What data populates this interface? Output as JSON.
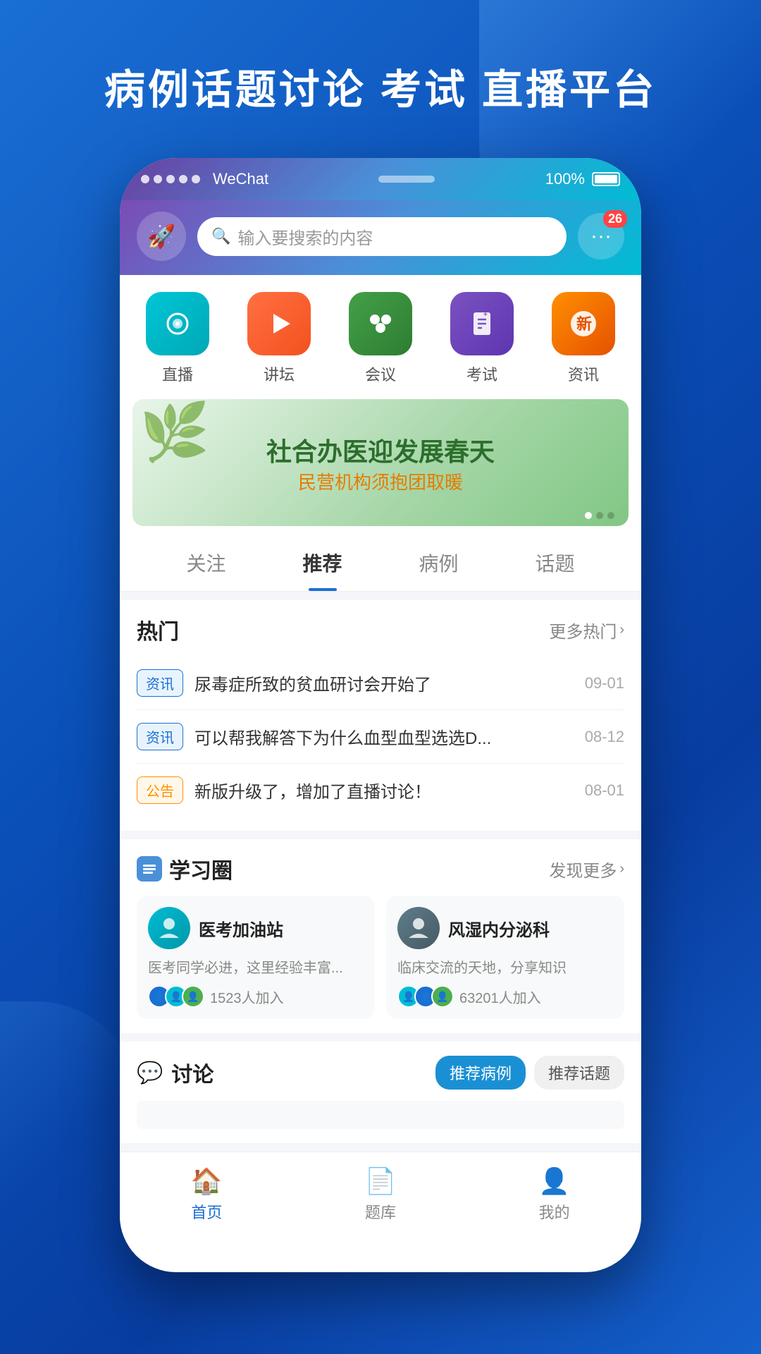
{
  "background": {
    "gradient_start": "#1a6fd4",
    "gradient_end": "#083da0"
  },
  "page_title": "病例话题讨论 考试 直播平台",
  "status_bar": {
    "app_name": "WeChat",
    "battery": "100%",
    "notification_count": "26"
  },
  "header": {
    "logo_icon": "🚀",
    "search_placeholder": "输入要搜索的内容",
    "notification_badge": "26"
  },
  "nav_icons": [
    {
      "label": "直播",
      "icon": "📡",
      "class": "icon-zibo"
    },
    {
      "label": "讲坛",
      "icon": "▶",
      "class": "icon-luntan"
    },
    {
      "label": "会议",
      "icon": "👥",
      "class": "icon-huiyi"
    },
    {
      "label": "考试",
      "icon": "📋",
      "class": "icon-kaoshi"
    },
    {
      "label": "资讯",
      "icon": "🎫",
      "class": "icon-zixun"
    }
  ],
  "banner": {
    "main_text": "社合办医迎发展春天",
    "sub_text": "民营机构须抱团取暖"
  },
  "tabs": [
    {
      "label": "关注",
      "active": false
    },
    {
      "label": "推荐",
      "active": true
    },
    {
      "label": "病例",
      "active": false
    },
    {
      "label": "话题",
      "active": false
    }
  ],
  "hot_section": {
    "title": "热门",
    "more_label": "更多热门",
    "items": [
      {
        "tag": "资讯",
        "tag_type": "zixun",
        "text": "尿毒症所致的贫血研讨会开始了",
        "date": "09-01"
      },
      {
        "tag": "资讯",
        "tag_type": "zixun",
        "text": "可以帮我解答下为什么血型血型选选D...",
        "date": "08-12"
      },
      {
        "tag": "公告",
        "tag_type": "gonggao",
        "text": "新版升级了，增加了直播讨论！",
        "date": "08-01"
      }
    ]
  },
  "learning_section": {
    "title": "学习圈",
    "more_label": "发现更多",
    "icon": "📋",
    "circles": [
      {
        "avatar_icon": "⚕",
        "name": "医考加油站",
        "desc": "医考同学必进，这里经验丰富...",
        "member_count": "1523人加入",
        "avatar_class": "circle-avatar-1"
      },
      {
        "avatar_icon": "🏥",
        "name": "风湿内分泌科",
        "desc": "临床交流的天地，分享知识",
        "member_count": "63201人加入",
        "avatar_class": "circle-avatar-2"
      }
    ]
  },
  "discussion_section": {
    "title": "讨论",
    "icon": "💬",
    "tabs": [
      {
        "label": "推荐病例",
        "active": true
      },
      {
        "label": "推荐话题",
        "active": false
      }
    ]
  },
  "bottom_nav": [
    {
      "label": "首页",
      "icon": "🏠",
      "active": true
    },
    {
      "label": "题库",
      "icon": "📄",
      "active": false
    },
    {
      "label": "我的",
      "icon": "👤",
      "active": false
    }
  ]
}
